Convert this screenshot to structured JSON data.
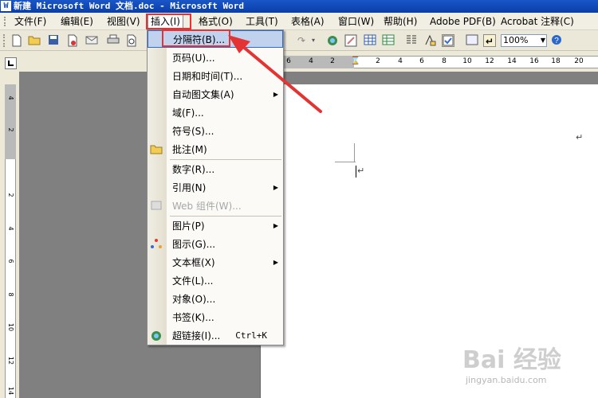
{
  "window": {
    "title": "新建 Microsoft Word 文档.doc - Microsoft Word",
    "app_icon": "W"
  },
  "menubar": {
    "items": [
      {
        "label": "文件(F)"
      },
      {
        "label": "编辑(E)"
      },
      {
        "label": "视图(V)"
      },
      {
        "label": "插入(I)",
        "active": true
      },
      {
        "label": "格式(O)"
      },
      {
        "label": "工具(T)"
      },
      {
        "label": "表格(A)"
      },
      {
        "label": "窗口(W)"
      },
      {
        "label": "帮助(H)"
      },
      {
        "label": "Adobe PDF(B)"
      },
      {
        "label": "Acrobat 注释(C)"
      }
    ]
  },
  "toolbar": {
    "zoom": "100%",
    "icons": [
      "new-doc-icon",
      "open-folder-icon",
      "save-icon",
      "permission-icon",
      "print-icon",
      "print-preview-icon",
      "redo-icon",
      "hyperlink-icon",
      "tables-borders-icon",
      "insert-table-icon",
      "insert-excel-icon",
      "columns-icon",
      "drawing-icon",
      "document-map-icon",
      "show-hide-icon",
      "help-icon"
    ]
  },
  "ruler": {
    "horizontal": [
      "6",
      "4",
      "2",
      "2",
      "4",
      "6",
      "8",
      "10",
      "12",
      "14",
      "16",
      "18",
      "20"
    ],
    "vertical": [
      "4",
      "2",
      "2",
      "4",
      "6",
      "8",
      "10",
      "12",
      "14"
    ]
  },
  "document": {
    "paragraph_mark": "↵"
  },
  "insert_menu": {
    "items": [
      {
        "label": "分隔符(B)...",
        "highlight": true
      },
      {
        "label": "页码(U)..."
      },
      {
        "label": "日期和时间(T)..."
      },
      {
        "label": "自动图文集(A)",
        "submenu": true
      },
      {
        "label": "域(F)..."
      },
      {
        "label": "符号(S)..."
      },
      {
        "label": "批注(M)",
        "icon": "comment-folder-icon"
      },
      {
        "label": "数字(R)..."
      },
      {
        "label": "引用(N)",
        "submenu": true
      },
      {
        "label": "Web 组件(W)...",
        "disabled": true,
        "icon": "web-component-icon"
      },
      {
        "label": "图片(P)",
        "submenu": true
      },
      {
        "label": "图示(G)...",
        "icon": "diagram-icon"
      },
      {
        "label": "文本框(X)",
        "submenu": true
      },
      {
        "label": "文件(L)..."
      },
      {
        "label": "对象(O)..."
      },
      {
        "label": "书签(K)..."
      },
      {
        "label": "超链接(I)...",
        "shortcut": "Ctrl+K",
        "icon": "hyperlink-globe-icon"
      }
    ]
  },
  "watermark": {
    "text": "Bai 经验",
    "url": "jingyan.baidu.com"
  },
  "colors": {
    "annotation_red": "#e43333",
    "highlight": "#c1d2ee",
    "titlebar": "#0a3ea8"
  }
}
